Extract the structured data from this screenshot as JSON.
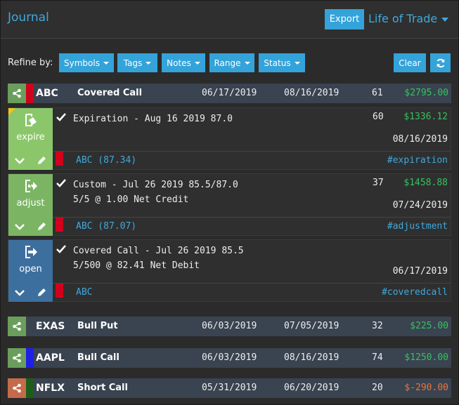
{
  "header": {
    "title": "Journal",
    "export_label": "Export",
    "period_label": "Life of Trade"
  },
  "filters": {
    "label": "Refine by:",
    "items": [
      {
        "label": "Symbols"
      },
      {
        "label": "Tags"
      },
      {
        "label": "Notes"
      },
      {
        "label": "Range"
      },
      {
        "label": "Status"
      }
    ],
    "clear_label": "Clear"
  },
  "colors": {
    "accent": "#34a3d9",
    "positive": "#35c25f",
    "negative": "#e8743b",
    "expire": "#8bc76a",
    "adjust": "#7bb564",
    "open": "#3d6f9e",
    "red_flag": "#d0021b",
    "blue_flag": "#1f1fe8",
    "green_flag": "#1b5e1b"
  },
  "trades": [
    {
      "symbol": "ABC",
      "strategy": "Covered Call",
      "open_date": "06/17/2019",
      "close_date": "08/16/2019",
      "days": "61",
      "pl": "$2795.00",
      "pl_sign": "positive",
      "flag_color": "red",
      "share_color": "green",
      "entries": [
        {
          "type": "expire",
          "icon": "expire-icon",
          "description": "Expiration - Aug 16 2019 87.0",
          "detail": "",
          "days": "60",
          "pl": "$1336.12",
          "date": "08/16/2019",
          "symbol_tag": "ABC (87.34)",
          "hashtag": "#expiration"
        },
        {
          "type": "adjust",
          "icon": "adjust-icon",
          "description": "Custom - Jul 26 2019 85.5/87.0",
          "detail": "5/5 @ 1.00 Net Credit",
          "days": "37",
          "pl": "$1458.88",
          "date": "07/24/2019",
          "symbol_tag": "ABC (87.07)",
          "hashtag": "#adjustment"
        },
        {
          "type": "open",
          "icon": "open-icon",
          "description": "Covered Call - Jul 26 2019 85.5",
          "detail": "5/500 @ 82.41 Net Debit",
          "days": "",
          "pl": "",
          "date": "06/17/2019",
          "symbol_tag": "ABC",
          "hashtag": "#coveredcall"
        }
      ]
    },
    {
      "symbol": "EXAS",
      "strategy": "Bull Put",
      "open_date": "06/03/2019",
      "close_date": "07/05/2019",
      "days": "32",
      "pl": "$225.00",
      "pl_sign": "positive",
      "flag_color": "none",
      "share_color": "green"
    },
    {
      "symbol": "AAPL",
      "strategy": "Bull Call",
      "open_date": "06/03/2019",
      "close_date": "08/16/2019",
      "days": "74",
      "pl": "$1250.00",
      "pl_sign": "positive",
      "flag_color": "blue",
      "share_color": "green"
    },
    {
      "symbol": "NFLX",
      "strategy": "Short Call",
      "open_date": "05/31/2019",
      "close_date": "06/20/2019",
      "days": "20",
      "pl": "$-290.00",
      "pl_sign": "negative",
      "flag_color": "green",
      "share_color": "orange"
    }
  ]
}
